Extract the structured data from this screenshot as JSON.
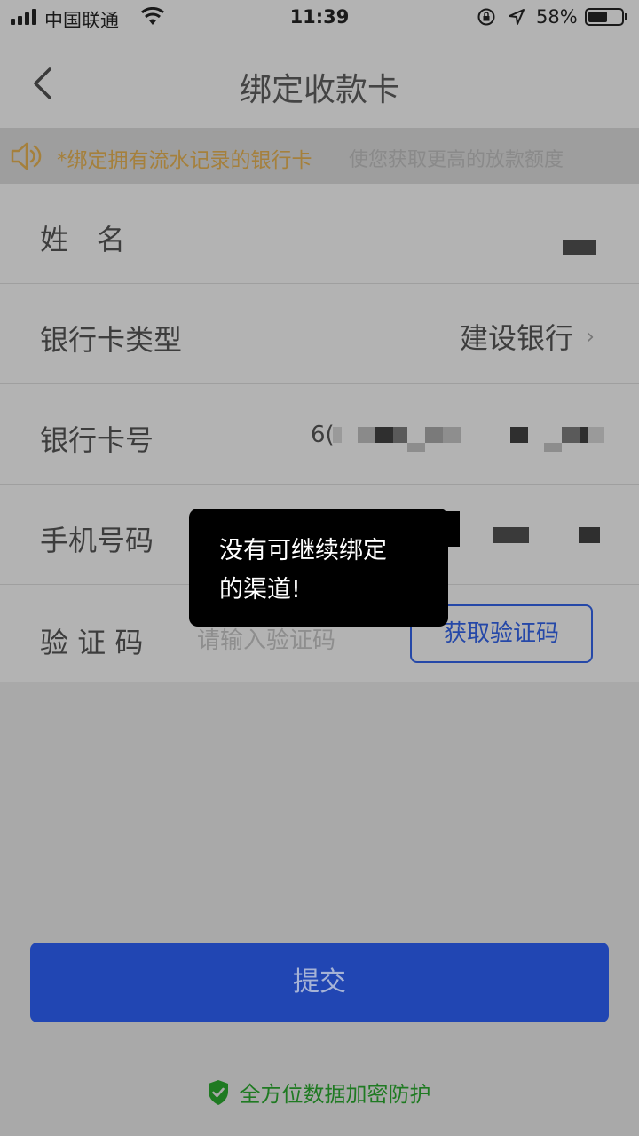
{
  "status_bar": {
    "carrier": "中国联通",
    "time": "11:39",
    "battery_percent": "58%",
    "battery_level": 0.58
  },
  "nav": {
    "title": "绑定收款卡"
  },
  "notice": {
    "highlight": "*绑定拥有流水记录的银行卡",
    "rest": "使您获取更高的放款额度"
  },
  "form": {
    "name_label": "姓　名",
    "bank_type_label": "银行卡类型",
    "bank_type_value": "建设银行",
    "card_number_label": "银行卡号",
    "card_number_visible": "6(",
    "phone_label": "手机号码",
    "code_label": "验 证 码",
    "code_placeholder": "请输入验证码",
    "get_code_button": "获取验证码"
  },
  "toast": {
    "line1": "没有可继续绑定",
    "line2": "的渠道!"
  },
  "submit_label": "提交",
  "security_note": "全方位数据加密防护",
  "colors": {
    "accent_blue": "#2146b3",
    "notice_orange": "#a5803c",
    "secure_green": "#1f7a22"
  }
}
